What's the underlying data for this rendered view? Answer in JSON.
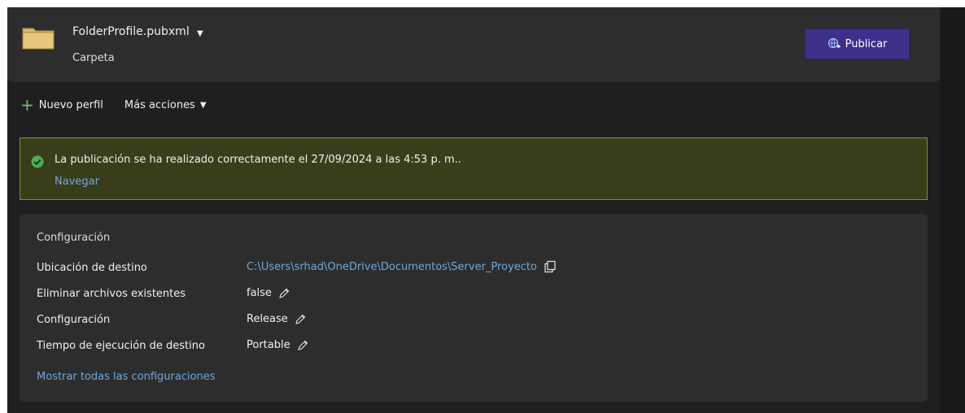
{
  "header": {
    "profile_name": "FolderProfile.pubxml",
    "profile_type": "Carpeta",
    "publish_label": "Publicar"
  },
  "toolbar": {
    "new_profile": "Nuevo perfil",
    "more_actions": "Más acciones"
  },
  "banner": {
    "message": "La publicación se ha realizado correctamente el 27/09/2024 a las 4:53 p. m..",
    "link": "Navegar"
  },
  "config": {
    "title": "Configuración",
    "rows": [
      {
        "label": "Ubicación de destino",
        "value": "C:\\Users\\srhad\\OneDrive\\Documentos\\Server_Proyecto"
      },
      {
        "label": "Eliminar archivos existentes",
        "value": "false"
      },
      {
        "label": "Configuración",
        "value": "Release"
      },
      {
        "label": "Tiempo de ejecución de destino",
        "value": "Portable"
      }
    ],
    "show_all": "Mostrar todas las configuraciones"
  },
  "colors": {
    "accent_button": "#3e2f8a",
    "link": "#6fa8dc",
    "success_border": "#6a9a2a",
    "success_bg": "#393d1c",
    "success_icon": "#4caf50"
  },
  "icons": [
    "folder-icon",
    "globe-publish-icon",
    "plus-icon",
    "caret-down-icon",
    "check-circle-icon",
    "copy-icon",
    "pencil-icon"
  ]
}
